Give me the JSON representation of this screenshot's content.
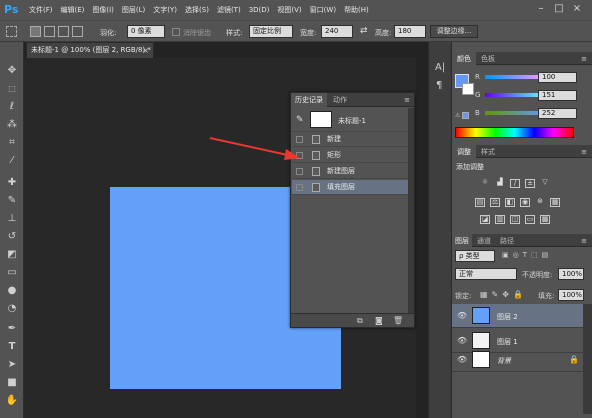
{
  "app": {
    "logo": "Ps"
  },
  "menu": [
    "文件(F)",
    "编辑(E)",
    "图像(I)",
    "图层(L)",
    "文字(Y)",
    "选择(S)",
    "滤镜(T)",
    "3D(D)",
    "视图(V)",
    "窗口(W)",
    "帮助(H)"
  ],
  "window_controls": {
    "minimize": "–",
    "maximize": "□",
    "close": "×"
  },
  "options": {
    "feather_label": "羽化:",
    "feather_value": "0 像素",
    "antialias_label": "消除锯齿",
    "style_label": "样式:",
    "style_value": "固定比例",
    "width_label": "宽度:",
    "width_value": "240",
    "swap_icon": "⇄",
    "height_label": "高度:",
    "height_value": "180",
    "refine_button": "调整边缘..."
  },
  "document": {
    "tab_title": "未标题-1 @ 100% (图层 2, RGB/8) *",
    "close": "×"
  },
  "history_panel": {
    "tabs": [
      "历史记录",
      "动作"
    ],
    "snapshot_label": "未标题-1",
    "items": [
      "新建",
      "矩形",
      "新建图层",
      "填充图层"
    ],
    "selected_index": 3
  },
  "color_panel": {
    "tabs": [
      "颜色",
      "色板"
    ],
    "channels": [
      {
        "label": "R",
        "value": "100"
      },
      {
        "label": "G",
        "value": "151"
      },
      {
        "label": "B",
        "value": "252"
      }
    ],
    "foreground": "#6497fc"
  },
  "adjustments_panel": {
    "tabs": [
      "调整",
      "样式"
    ],
    "title": "添加调整"
  },
  "layers_panel": {
    "tabs": [
      "图层",
      "通道",
      "路径"
    ],
    "filter_label": "ρ 类型",
    "blend_mode": "正常",
    "opacity_label": "不透明度:",
    "opacity_value": "100%",
    "lock_label": "锁定:",
    "fill_label": "填充:",
    "fill_value": "100%",
    "layers": [
      {
        "name": "图层 2",
        "selected": true,
        "thumb": "#63a0fa"
      },
      {
        "name": "图层 1",
        "selected": false,
        "thumb": "#f2f2f2"
      },
      {
        "name": "背景",
        "selected": false,
        "thumb": "#ffffff"
      }
    ]
  },
  "colors": {
    "canvas_fill": "#63a0fa",
    "arrow": "#e8382f",
    "selection_highlight": "#677384"
  }
}
